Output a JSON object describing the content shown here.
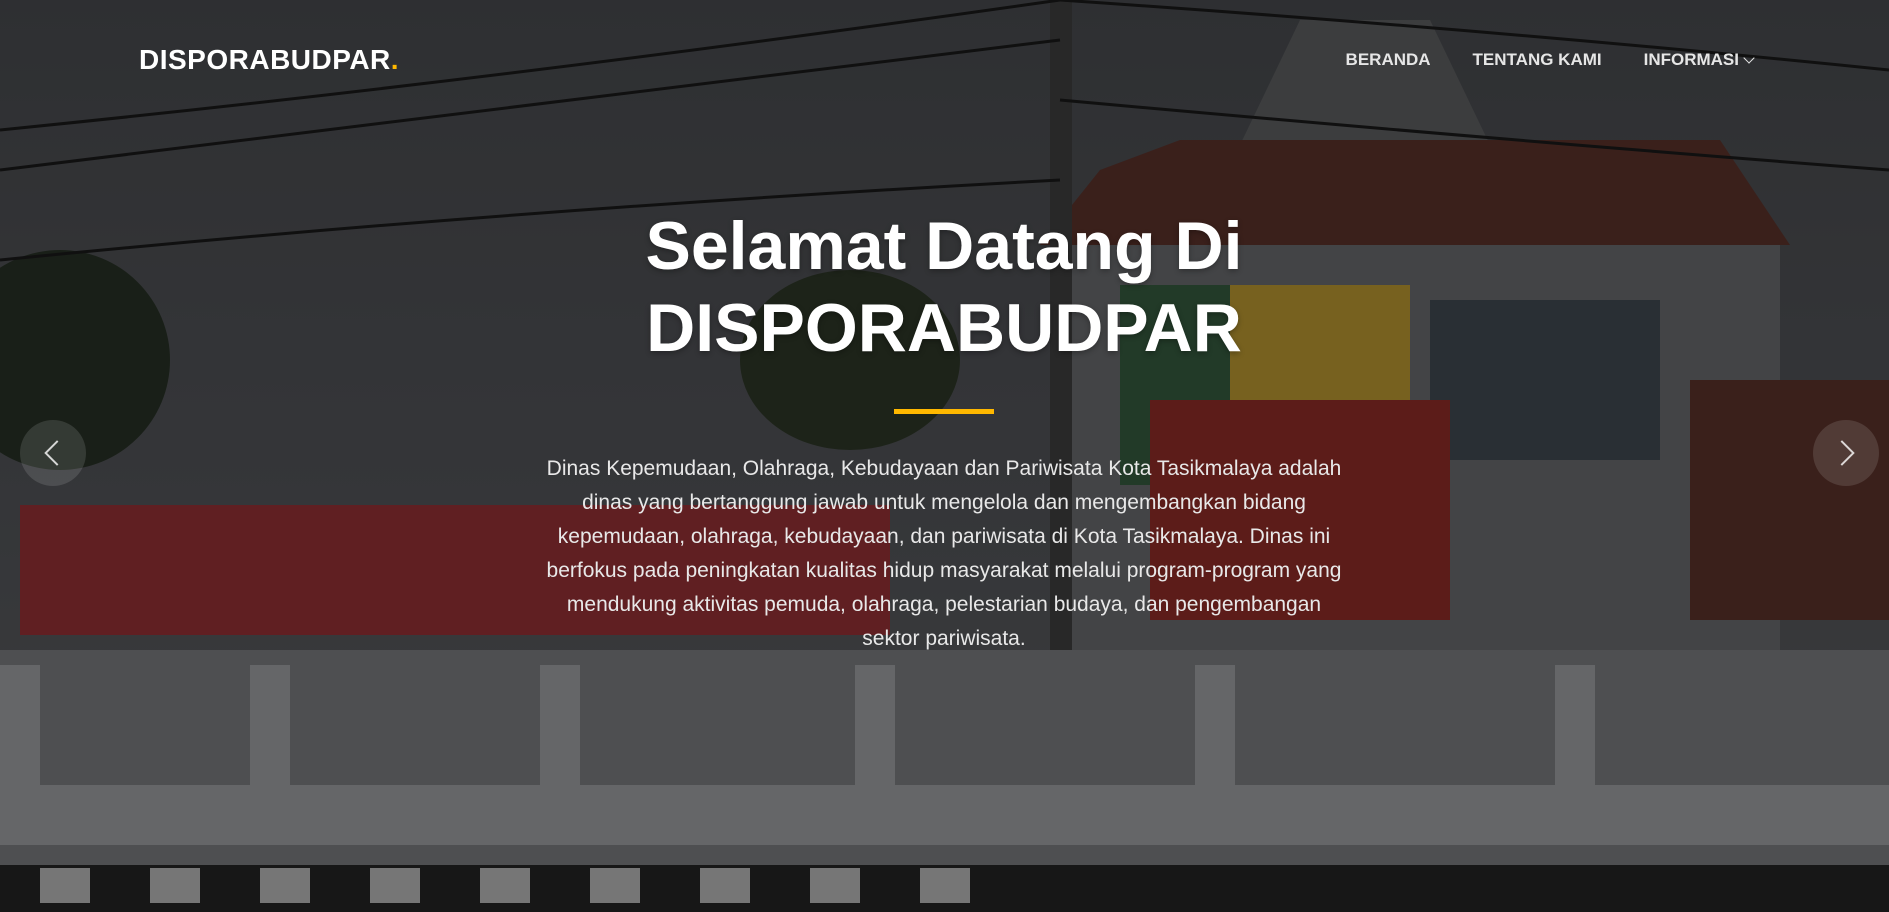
{
  "header": {
    "logo_text": "DISPORABUDPAR",
    "logo_dot": ".",
    "nav": [
      {
        "label": "BERANDA"
      },
      {
        "label": "TENTANG KAMI"
      },
      {
        "label": "INFORMASI",
        "icon": "chevron-down-icon"
      }
    ]
  },
  "hero": {
    "title_line1": "Selamat Datang Di",
    "title_line2": "DISPORABUDPAR",
    "description": "Dinas Kepemudaan, Olahraga, Kebudayaan dan Pariwisata Kota Tasikmalaya adalah dinas yang bertanggung jawab untuk mengelola dan mengembangkan bidang kepemudaan, olahraga, kebudayaan, dan pariwisata di Kota Tasikmalaya. Dinas ini berfokus pada peningkatan kualitas hidup masyarakat melalui program-program yang mendukung aktivitas pemuda, olahraga, pelestarian budaya, dan pengembangan sektor pariwisata.",
    "accent_color": "#ffb800"
  },
  "carousel": {
    "prev_icon": "chevron-left-icon",
    "next_icon": "chevron-right-icon"
  }
}
